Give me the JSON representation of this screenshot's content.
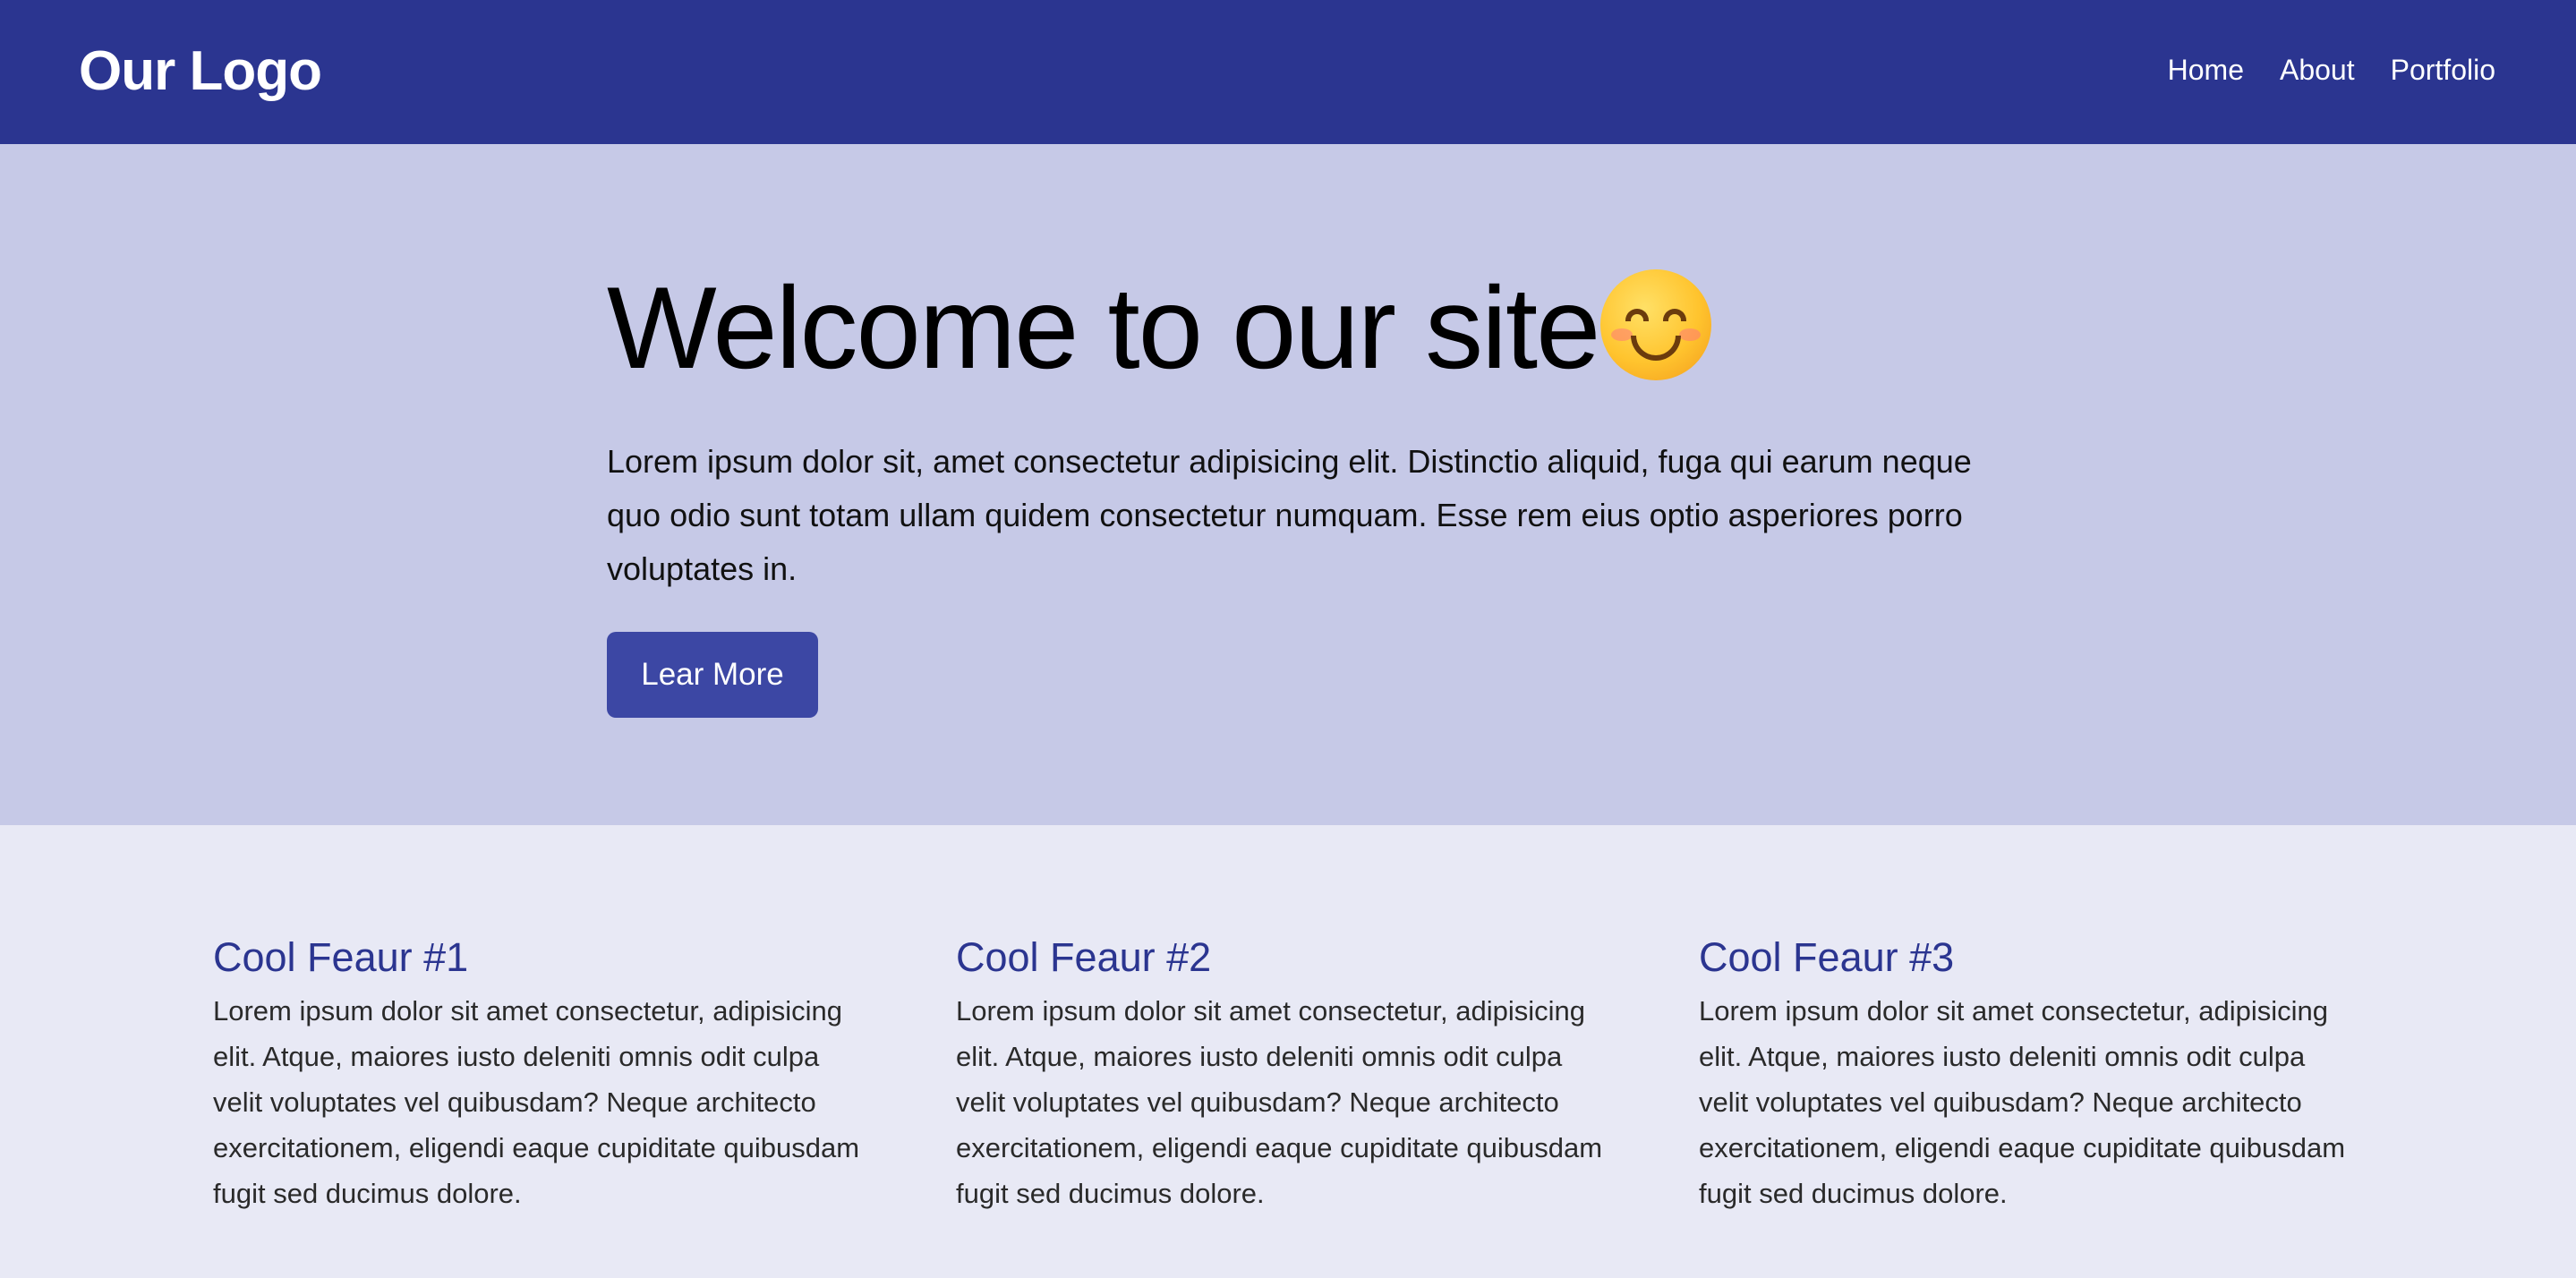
{
  "navbar": {
    "logo": "Our Logo",
    "links": [
      "Home",
      "About",
      "Portfolio"
    ]
  },
  "hero": {
    "title": "Welcome to our site",
    "emoji": "smiling-face-icon",
    "text": "Lorem ipsum dolor sit, amet consectetur adipisicing elit. Distinctio aliquid, fuga qui earum neque quo odio sunt totam ullam quidem consectetur numquam. Esse rem eius optio asperiores porro voluptates in.",
    "button_label": "Lear More"
  },
  "features": [
    {
      "title": "Cool Feaur #1",
      "text": "Lorem ipsum dolor sit amet consectetur, adipisicing elit. Atque, maiores iusto deleniti omnis odit culpa velit voluptates vel quibusdam? Neque architecto exercitationem, eligendi eaque cupiditate quibusdam fugit sed ducimus dolore."
    },
    {
      "title": "Cool Feaur #2",
      "text": "Lorem ipsum dolor sit amet consectetur, adipisicing elit. Atque, maiores iusto deleniti omnis odit culpa velit voluptates vel quibusdam? Neque architecto exercitationem, eligendi eaque cupiditate quibusdam fugit sed ducimus dolore."
    },
    {
      "title": "Cool Feaur #3",
      "text": "Lorem ipsum dolor sit amet consectetur, adipisicing elit. Atque, maiores iusto deleniti omnis odit culpa velit voluptates vel quibusdam? Neque architecto exercitationem, eligendi eaque cupiditate quibusdam fugit sed ducimus dolore."
    }
  ],
  "colors": {
    "navbar_bg": "#2b3590",
    "hero_bg": "#c6c9e7",
    "button_bg": "#3c47a4",
    "features_bg": "#e8e9f5",
    "feature_title": "#2b3590"
  }
}
